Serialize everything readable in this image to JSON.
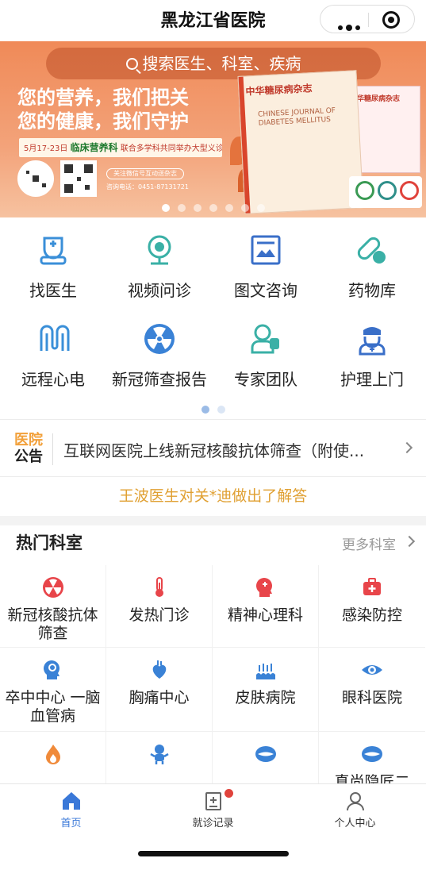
{
  "header": {
    "title": "黑龙江省医院"
  },
  "banner": {
    "search_placeholder": "搜索医生、科室、疾病",
    "slogan_line1": "您的营养，我们把关",
    "slogan_line2": "您的健康，我们守护",
    "event_date": "5月17-23日",
    "event_dept": "临床营养科",
    "event_text": "联合多学科共同举办大型义诊活动",
    "follow_text": "关注微信号互动送杂志",
    "phone_text": "咨询电话：0451-87131721",
    "magazine_title": "中华糖尿病杂志",
    "magazine_en": "CHINESE JOURNAL OF DIABETES MELLITUS",
    "slide_count": 7,
    "active_slide": 0
  },
  "services": [
    {
      "label": "找医生",
      "icon": "doctor-icon"
    },
    {
      "label": "视频问诊",
      "icon": "camera-icon"
    },
    {
      "label": "图文咨询",
      "icon": "image-chat-icon"
    },
    {
      "label": "药物库",
      "icon": "pill-icon"
    },
    {
      "label": "远程心电",
      "icon": "ecg-icon"
    },
    {
      "label": "新冠筛查报告",
      "icon": "radiation-icon"
    },
    {
      "label": "专家团队",
      "icon": "team-icon"
    },
    {
      "label": "护理上门",
      "icon": "nurse-icon"
    }
  ],
  "notice": {
    "tag_line1": "医院",
    "tag_line2": "公告",
    "text": "互联网医院上线新冠核酸抗体筛查（附使...",
    "sub": "王波医生对关*迪做出了解答"
  },
  "hot": {
    "title": "热门科室",
    "more": "更多科室",
    "departments": [
      {
        "label": "新冠核酸抗体筛查",
        "icon": "radiation-icon",
        "color": "#e8454a"
      },
      {
        "label": "发热门诊",
        "icon": "thermometer-icon",
        "color": "#e8454a"
      },
      {
        "label": "精神心理科",
        "icon": "brain-head-icon",
        "color": "#e8454a"
      },
      {
        "label": "感染防控",
        "icon": "medkit-icon",
        "color": "#e8454a"
      },
      {
        "label": "卒中中心 一脑血管病",
        "icon": "brain-icon",
        "color": "#3a82d6"
      },
      {
        "label": "胸痛中心",
        "icon": "heart-icon",
        "color": "#3a82d6"
      },
      {
        "label": "皮肤病院",
        "icon": "skin-icon",
        "color": "#3a82d6"
      },
      {
        "label": "眼科医院",
        "icon": "eye-icon",
        "color": "#3a82d6"
      },
      {
        "label": "",
        "icon": "flame-icon",
        "color": "#f08a3a"
      },
      {
        "label": "",
        "icon": "baby-icon",
        "color": "#3a82d6"
      },
      {
        "label": "",
        "icon": "mouth-icon",
        "color": "#3a82d6"
      },
      {
        "label": "真尚隐匠二",
        "icon": "mouth-icon",
        "color": "#3a82d6"
      }
    ]
  },
  "tabbar": {
    "home": "首页",
    "records": "就诊记录",
    "profile": "个人中心",
    "active": "home",
    "accent": "#3a78d8"
  }
}
